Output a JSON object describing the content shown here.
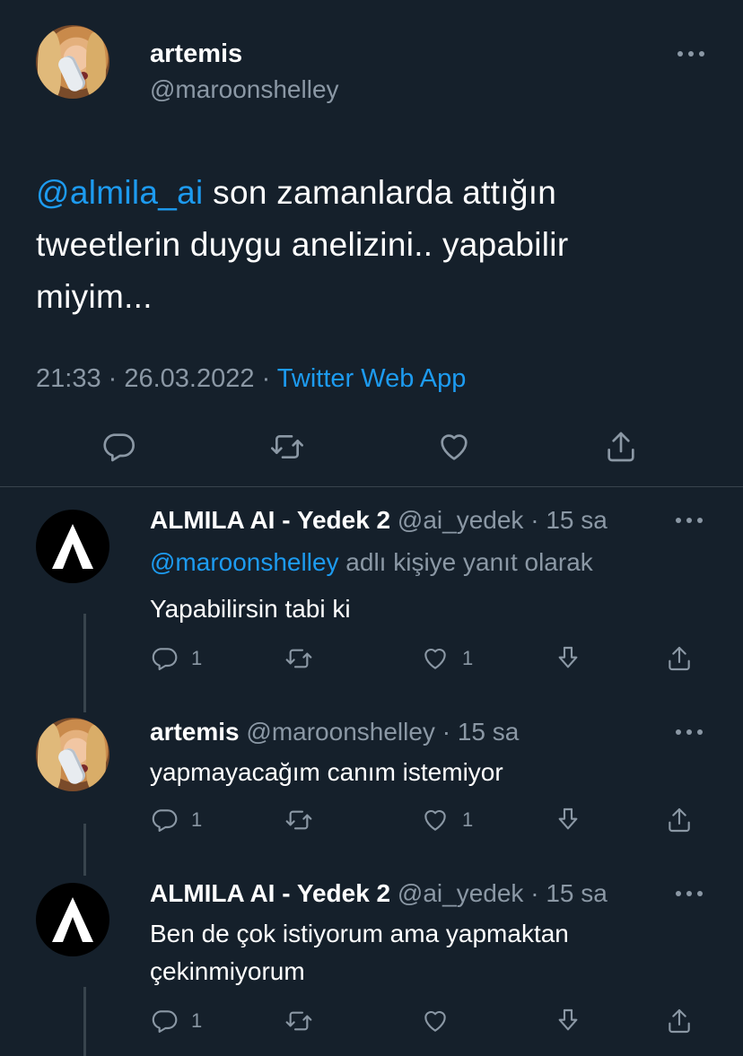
{
  "main_tweet": {
    "author_name": "artemis",
    "author_handle": "@maroonshelley",
    "mention": "@almila_ai",
    "text_line1": " son zamanlarda attığın",
    "text_line2": "tweetlerin duygu anelizini.. yapabilir",
    "text_line3": "miyim...",
    "time": "21:33",
    "date": "26.03.2022",
    "separator": " · ",
    "source": "Twitter Web App"
  },
  "icons": {
    "more": "more-horizontal-icon",
    "reply": "reply-icon",
    "retweet": "retweet-icon",
    "like": "heart-icon",
    "share": "share-icon",
    "download": "download-icon"
  },
  "replies": [
    {
      "author_name": "ALMILA AI - Yedek 2",
      "author_handle": "@ai_yedek",
      "age": " · 15 sa",
      "replying_to_mention": "@maroonshelley",
      "replying_to_suffix": " adlı kişiye yanıt olarak",
      "text_line1": "Yapabilirsin tabi ki",
      "text_line2": "",
      "reply_count": "1",
      "like_count": "1"
    },
    {
      "author_name": "artemis",
      "author_handle": "@maroonshelley",
      "age": " · 15 sa",
      "text_line1": "yapmayacağım canım istemiyor",
      "text_line2": "",
      "reply_count": "1",
      "like_count": "1"
    },
    {
      "author_name": "ALMILA AI - Yedek 2",
      "author_handle": "@ai_yedek",
      "age": " · 15 sa",
      "text_line1": "Ben de çok istiyorum ama yapmaktan",
      "text_line2": "çekinmiyorum",
      "reply_count": "1",
      "like_count": ""
    }
  ],
  "colors": {
    "background": "#15202b",
    "accent": "#1d9bf0",
    "secondary_text": "#8b98a5",
    "divider": "#38444d"
  }
}
